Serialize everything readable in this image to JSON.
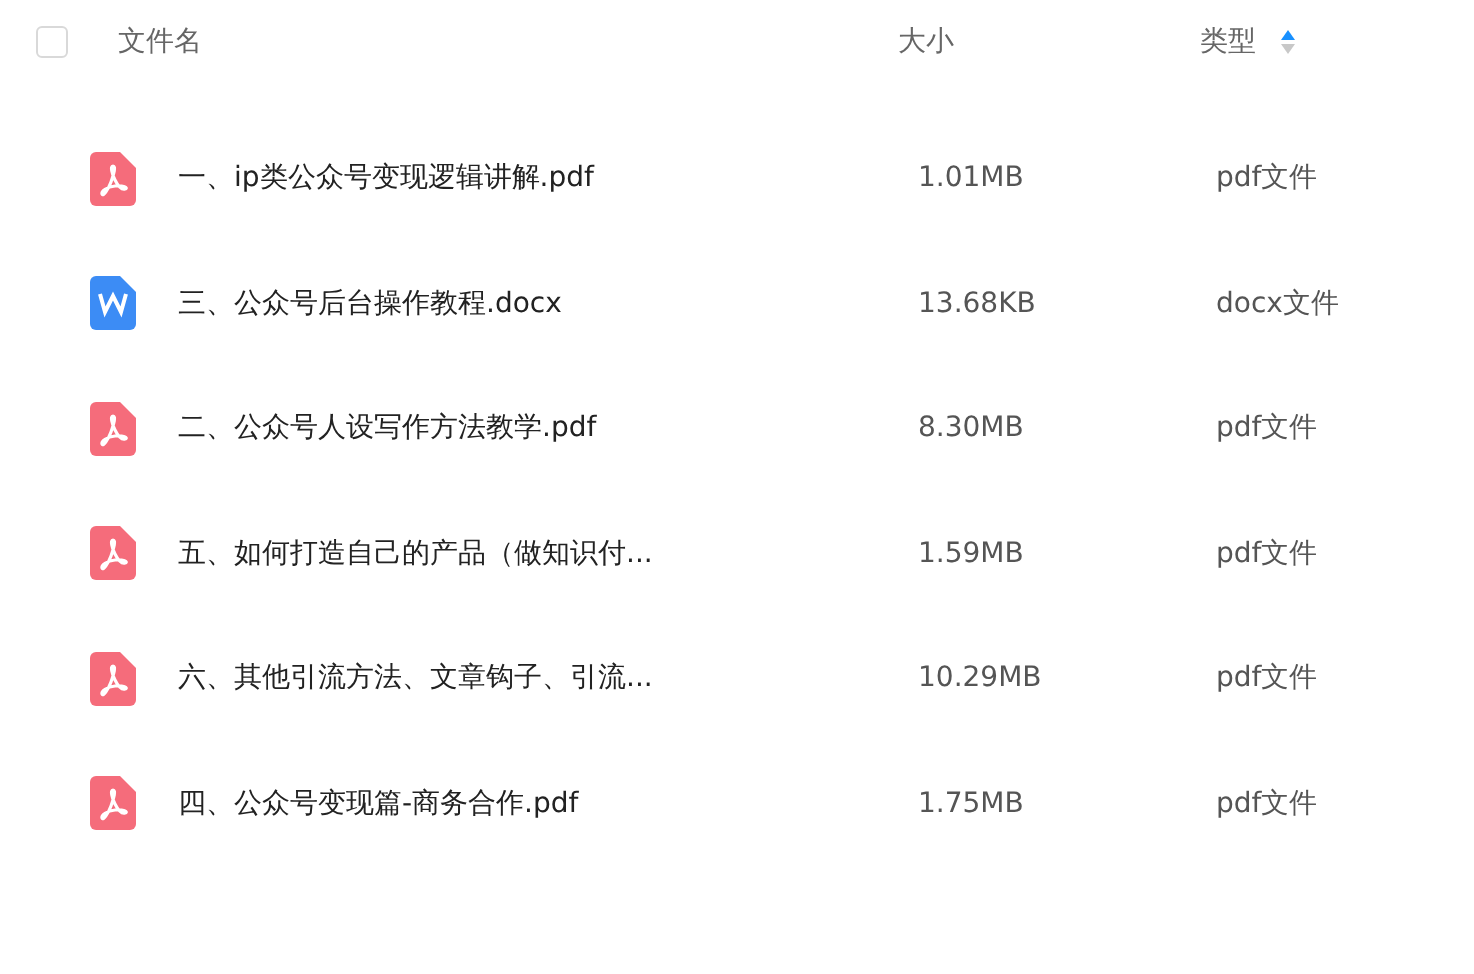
{
  "header": {
    "checked": false,
    "columns": [
      {
        "label": "文件名"
      },
      {
        "label": "大小"
      },
      {
        "label": "类型",
        "sorted": true
      }
    ]
  },
  "files": [
    {
      "kind": "pdf",
      "name": "一、ip类公众号变现逻辑讲解.pdf",
      "size": "1.01MB",
      "type": "pdf文件"
    },
    {
      "kind": "docx",
      "name": "三、公众号后台操作教程.docx",
      "size": "13.68KB",
      "type": "docx文件"
    },
    {
      "kind": "pdf",
      "name": "二、公众号人设写作方法教学.pdf",
      "size": "8.30MB",
      "type": "pdf文件"
    },
    {
      "kind": "pdf",
      "name": "五、如何打造自己的产品（做知识付...",
      "size": "1.59MB",
      "type": "pdf文件"
    },
    {
      "kind": "pdf",
      "name": "六、其他引流方法、文章钩子、引流...",
      "size": "10.29MB",
      "type": "pdf文件"
    },
    {
      "kind": "pdf",
      "name": "四、公众号变现篇-商务合作.pdf",
      "size": "1.75MB",
      "type": "pdf文件"
    }
  ]
}
